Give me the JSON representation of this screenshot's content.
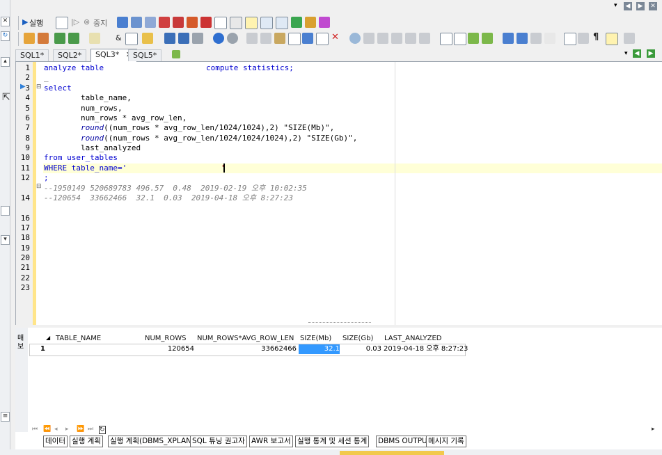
{
  "toolbar1": {
    "run_label": "실행",
    "stop_label": "중지"
  },
  "tabs": [
    {
      "label": "SQL1*"
    },
    {
      "label": "SQL2*"
    },
    {
      "label": "SQL3*"
    },
    {
      "label": "SQL5*"
    }
  ],
  "editor": {
    "line_numbers": [
      "1",
      "2",
      "3",
      "4",
      "5",
      "6",
      "7",
      "8",
      "9",
      "10",
      "11",
      "12",
      "",
      "14",
      "",
      "16",
      "17",
      "18",
      "19",
      "20",
      "21",
      "22",
      "23"
    ],
    "lines": {
      "l1a": "analyze table",
      "l1b": "compute statistics;",
      "l2": "_",
      "l3": "select",
      "l4": "        table_name,",
      "l5": "        num_rows,",
      "l6": "        num_rows * avg_row_len,",
      "l7_fn": "round",
      "l7_rest": "((num_rows * avg_row_len/1024/1024),2) \"SIZE(Mb)\",",
      "l8_fn": "round",
      "l8_rest": "((num_rows * avg_row_len/1024/1024/1024),2) \"SIZE(Gb)\",",
      "l9": "        last_analyzed",
      "l10": "from user_tables",
      "l11a": "WHERE table_name='",
      "l11b": "'",
      "l12": ";",
      "c1": "--1950149 520689783 496.57  0.48  2019-02-19 오후 10:02:35",
      "c2": "--120654  33662466  32.1  0.03  2019-04-18 오후 8:27:23"
    }
  },
  "results": {
    "columns": [
      "TABLE_NAME",
      "NUM_ROWS",
      "NUM_ROWS*AVG_ROW_LEN",
      "SIZE(Mb)",
      "SIZE(Gb)",
      "LAST_ANALYZED"
    ],
    "row": {
      "num": "1",
      "num_rows": "120654",
      "num_rows_avg": "33662466",
      "size_mb": "32.1",
      "size_gb": "0.03",
      "last_analyzed": "2019-04-18 오후 8:27:23"
    },
    "side_label": "매보"
  },
  "bottom_tabs": [
    "데이터",
    "실행 계획",
    "실행 계획(DBMS_XPLAN)",
    "SQL 튜닝 권고자",
    "AWR 보고서",
    "실행 통계 및 세션 통계",
    "DBMS OUTPUT",
    "메시지 기록"
  ],
  "colors": {
    "selected_cell": "#3399ff",
    "current_line": "#ffffd7",
    "bookmark": "#ffe58a"
  }
}
